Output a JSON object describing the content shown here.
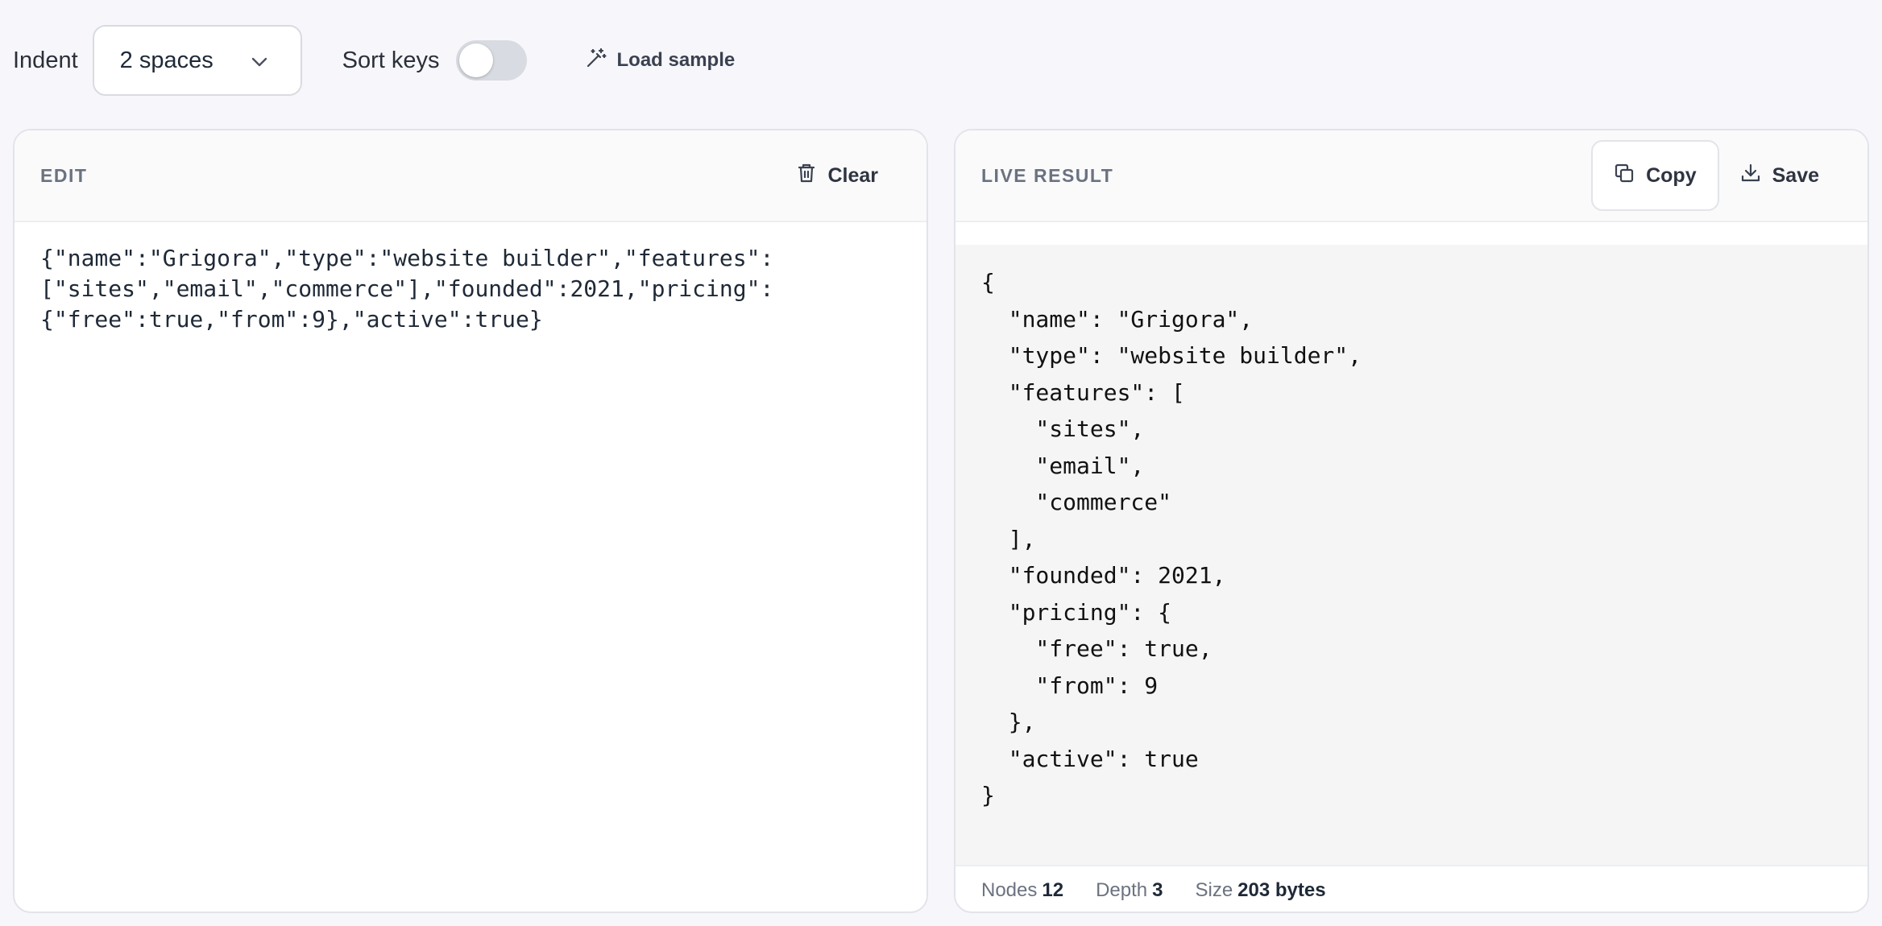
{
  "toolbar": {
    "indent_label": "Indent",
    "indent_value": "2 spaces",
    "sort_keys_label": "Sort keys",
    "sort_keys_on": false,
    "load_sample_label": "Load sample"
  },
  "edit_panel": {
    "title": "EDIT",
    "clear_label": "Clear",
    "content": "{\"name\":\"Grigora\",\"type\":\"website builder\",\"features\":\n[\"sites\",\"email\",\"commerce\"],\"founded\":2021,\"pricing\":\n{\"free\":true,\"from\":9},\"active\":true}"
  },
  "result_panel": {
    "title": "LIVE RESULT",
    "copy_label": "Copy",
    "save_label": "Save",
    "content": "{\n  \"name\": \"Grigora\",\n  \"type\": \"website builder\",\n  \"features\": [\n    \"sites\",\n    \"email\",\n    \"commerce\"\n  ],\n  \"founded\": 2021,\n  \"pricing\": {\n    \"free\": true,\n    \"from\": 9\n  },\n  \"active\": true\n}",
    "stats": {
      "nodes_label": "Nodes",
      "nodes_value": "12",
      "depth_label": "Depth",
      "depth_value": "3",
      "size_label": "Size",
      "size_value": "203 bytes"
    }
  },
  "icons": {
    "chevron": "chevron-down-icon",
    "wand": "magic-wand-icon",
    "trash": "trash-icon",
    "copy": "copy-icon",
    "download": "download-icon"
  }
}
